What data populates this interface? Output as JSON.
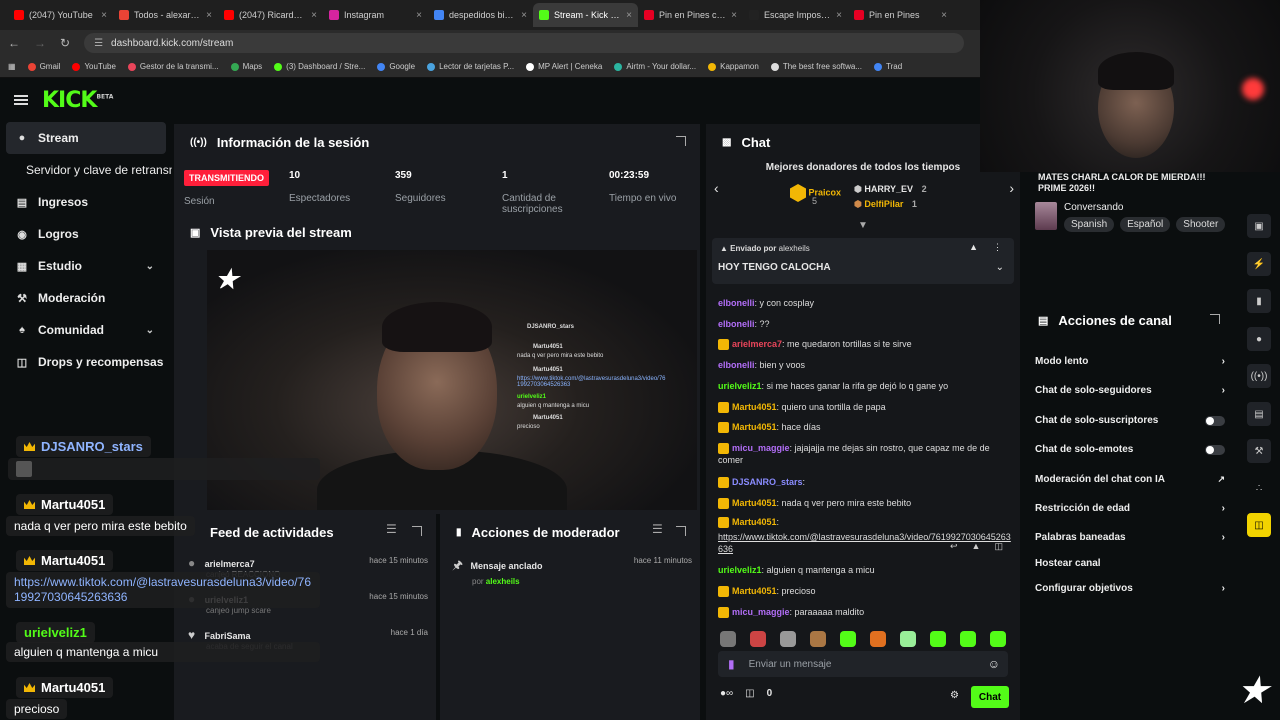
{
  "browser": {
    "tabs": [
      {
        "title": "(2047) YouTube",
        "color": "#ff0000"
      },
      {
        "title": "Todos - alexariell",
        "color": "#ea4335"
      },
      {
        "title": "(2047) Ricardo Ar",
        "color": "#ff0000"
      },
      {
        "title": "Instagram",
        "color": "#d6249f"
      },
      {
        "title": "despedidos bichc",
        "color": "#4285f4"
      },
      {
        "title": "Stream - Kick Das",
        "color": "#53fc18",
        "active": true
      },
      {
        "title": "Pin en Pines crea",
        "color": "#e60023"
      },
      {
        "title": "Escape Imposible",
        "color": "#222222"
      },
      {
        "title": "Pin en Pines",
        "color": "#e60023"
      }
    ],
    "url": "dashboard.kick.com/stream",
    "bookmarks": [
      "Gmail",
      "YouTube",
      "Gestor de la transmi...",
      "Maps",
      "(3) Dashboard / Stre...",
      "Google",
      "Lector de tarjetas P...",
      "MP Alert | Ceneka",
      "Airtm - Your dollar...",
      "Kappamon",
      "The best free softwa...",
      "Trad"
    ]
  },
  "kick": {
    "logo": "KICK",
    "logo_sup": "BETA"
  },
  "sidebar": {
    "stream": "Stream",
    "server_key": "Servidor y clave de retransm",
    "items": [
      "Ingresos",
      "Logros",
      "Estudio",
      "Moderación",
      "Comunidad",
      "Drops y recompensas"
    ]
  },
  "session": {
    "title": "Información de la sesión",
    "live": "TRANSMITIENDO",
    "session_label": "Sesión",
    "viewers": "10",
    "viewers_label": "Espectadores",
    "followers": "359",
    "followers_label": "Seguidores",
    "subs": "1",
    "subs_label": "Cantidad de suscripciones",
    "time": "00:23:59",
    "time_label": "Tiempo en vivo"
  },
  "preview": {
    "title": "Vista previa del stream",
    "mini": [
      "DJSANRO_stars",
      "Martu4051",
      "nada q ver pero mira este bebito",
      "Martu4051",
      "https://www.tiktok.com/@lastravesurasdeluna3/video/761992703064526363",
      "urielveliz1",
      "alguien q mantenga a micu",
      "Martu4051",
      "precioso"
    ]
  },
  "overlay": {
    "u1": "DJSANRO_stars",
    "u2": "Martu4051",
    "m2": "nada q ver pero mira este bebito",
    "u3": "Martu4051",
    "m3": "https://www.tiktok.com/@lastravesurasdeluna3/video/7619927030645263636",
    "u4": "urielveliz1",
    "m4": "alguien q mantenga a micu",
    "u5": "Martu4051",
    "m5": "precioso"
  },
  "feed": {
    "title": "Feed de actividades",
    "items": [
      {
        "user": "arielmerca7",
        "sub": "canjeó REACCIONO",
        "time": "hace 15 minutos"
      },
      {
        "user": "urielveliz1",
        "sub": "canjeó jump scare",
        "time": "hace 15 minutos"
      },
      {
        "user": "FabriSama",
        "sub": "acaba de seguir el canal",
        "time": "hace 1 día"
      }
    ]
  },
  "mod": {
    "title": "Acciones de moderador",
    "item": "Mensaje anclado",
    "by": "por",
    "by_user": "alexheils",
    "time": "hace 11 minutos"
  },
  "chat": {
    "title": "Chat",
    "donors_title": "Mejores donadores de todos los tiempos",
    "donors": [
      {
        "name": "Praicox",
        "n": "5"
      },
      {
        "name": "HARRY_EV",
        "n": "2"
      },
      {
        "name": "DelfiPilar",
        "n": "1"
      }
    ],
    "pinned_by": "Enviado por",
    "pinned_user": "alexheils",
    "pinned_msg": "HOY TENGO CALOCHA",
    "messages": [
      {
        "user": "elbonelli",
        "color": "#b26ef7",
        "text": ": y con cosplay"
      },
      {
        "user": "elbonelli",
        "color": "#b26ef7",
        "text": ": ??"
      },
      {
        "user": "arielmerca7",
        "color": "#e9455a",
        "text": ": me quedaron tortillas si te sirve"
      },
      {
        "user": "elbonelli",
        "color": "#b26ef7",
        "text": ": bien y voos"
      },
      {
        "user": "urielveliz1",
        "color": "#53fc18",
        "text": ": si me haces ganar la rifa ge dejó lo q gane yo"
      },
      {
        "user": "Martu4051",
        "color": "#f2b705",
        "text": ": quiero una tortilla de papa"
      },
      {
        "user": "Martu4051",
        "color": "#f2b705",
        "text": ": hace días"
      },
      {
        "user": "micu_maggie",
        "color": "#b26ef7",
        "text": ": jajajajja me dejas sin rostro, que capaz me de de comer"
      },
      {
        "user": "DJSANRO_stars",
        "color": "#8a8cff",
        "text": ":"
      },
      {
        "user": "Martu4051",
        "color": "#f2b705",
        "text": ": nada q ver pero mira este bebito"
      },
      {
        "user": "Martu4051",
        "color": "#f2b705",
        "text": ":"
      },
      {
        "user": "",
        "color": "#ffffff",
        "text": "https://www.tiktok.com/@lastravesurasdeluna3/video/7619927030645263636"
      },
      {
        "user": "urielveliz1",
        "color": "#53fc18",
        "text": ": alguien q mantenga a micu"
      },
      {
        "user": "Martu4051",
        "color": "#f2b705",
        "text": ": precioso"
      },
      {
        "user": "micu_maggie",
        "color": "#b26ef7",
        "text": ": paraaaaa maldito"
      }
    ],
    "input_placeholder": "Enviar un mensaje",
    "count": "0",
    "send": "Chat"
  },
  "stream_info": {
    "title_line": "MATES CHARLA CALOR DE MIERDA!!! PRIME 2026!!",
    "category": "Conversando",
    "tags": [
      "Spanish",
      "Español",
      "Shooter"
    ]
  },
  "actions": {
    "title": "Acciones de canal",
    "items": [
      "Modo lento",
      "Chat de solo-seguidores",
      "Chat de solo-suscriptores",
      "Chat de solo-emotes",
      "Moderación del chat con IA",
      "Restricción de edad",
      "Palabras baneadas",
      "Hostear canal",
      "Configurar objetivos"
    ]
  }
}
